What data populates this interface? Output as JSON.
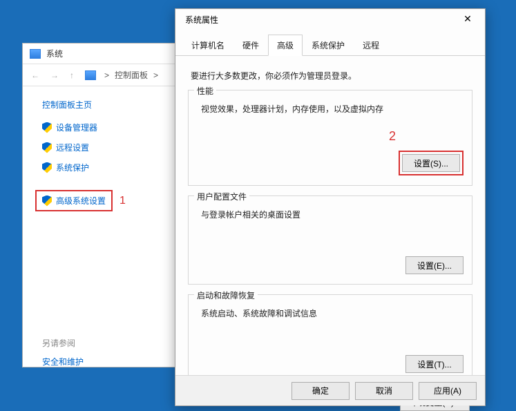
{
  "desktop": {
    "bg": "#1a6db8"
  },
  "sys_window": {
    "title": "系统",
    "breadcrumb_root": "控制面板",
    "breadcrumb_sep": ">",
    "cp_home": "控制面板主页",
    "links": [
      {
        "label": "设备管理器",
        "shield": true
      },
      {
        "label": "远程设置",
        "shield": true
      },
      {
        "label": "系统保护",
        "shield": true
      },
      {
        "label": "高级系统设置",
        "shield": true,
        "highlighted": true
      }
    ],
    "see_also": "另请参阅",
    "safe_link": "安全和维护"
  },
  "annotations": {
    "one": "1",
    "two": "2"
  },
  "dialog": {
    "title": "系统属性",
    "close": "✕",
    "tabs": [
      {
        "label": "计算机名"
      },
      {
        "label": "硬件"
      },
      {
        "label": "高级",
        "active": true
      },
      {
        "label": "系统保护"
      },
      {
        "label": "远程"
      }
    ],
    "intro": "要进行大多数更改，你必须作为管理员登录。",
    "groups": {
      "perf": {
        "title": "性能",
        "desc": "视觉效果，处理器计划，内存使用，以及虚拟内存",
        "btn": "设置(S)..."
      },
      "profile": {
        "title": "用户配置文件",
        "desc": "与登录帐户相关的桌面设置",
        "btn": "设置(E)..."
      },
      "startup": {
        "title": "启动和故障恢复",
        "desc": "系统启动、系统故障和调试信息",
        "btn": "设置(T)..."
      }
    },
    "env_btn": "环境变量(N)...",
    "footer": {
      "ok": "确定",
      "cancel": "取消",
      "apply": "应用(A)"
    }
  }
}
